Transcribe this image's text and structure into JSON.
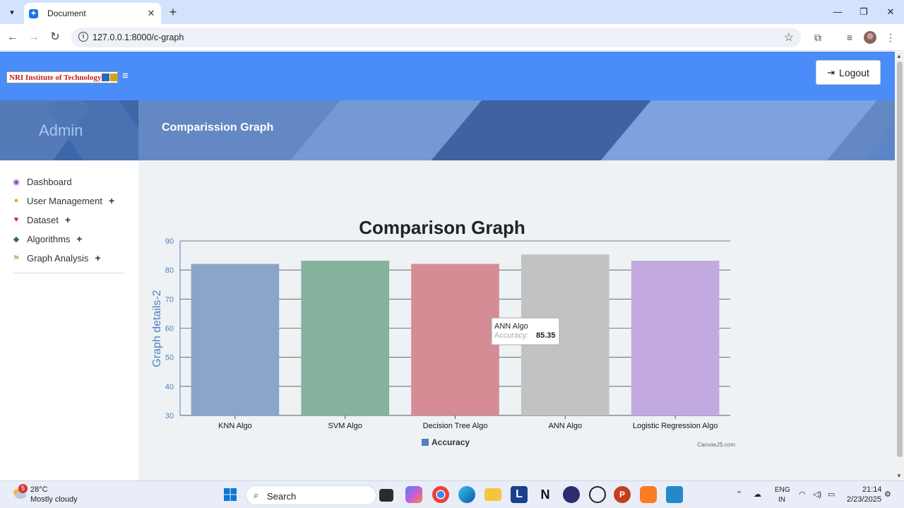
{
  "browser": {
    "tab_title": "Document",
    "url": "127.0.0.1:8000/c-graph"
  },
  "header": {
    "logo_text": "NRI Institute of Technology",
    "logout_label": "Logout"
  },
  "banner": {
    "admin_label": "Admin",
    "page_title": "Comparission Graph"
  },
  "sidebar": {
    "items": [
      {
        "label": "Dashboard",
        "icon": "dashboard-icon",
        "expandable": false
      },
      {
        "label": "User Management",
        "icon": "users-icon",
        "expandable": true
      },
      {
        "label": "Dataset",
        "icon": "heart-icon",
        "expandable": true
      },
      {
        "label": "Algorithms",
        "icon": "tags-icon",
        "expandable": true
      },
      {
        "label": "Graph Analysis",
        "icon": "flag-icon",
        "expandable": true
      }
    ]
  },
  "chart_data": {
    "type": "bar",
    "title": "Comparison Graph",
    "ylabel": "Graph details-2",
    "xlabel": "",
    "categories": [
      "KNN Algo",
      "SVM Algo",
      "Decision Tree Algo",
      "ANN Algo",
      "Logistic Regression Algo"
    ],
    "series": [
      {
        "name": "Accuracy",
        "values": [
          82.1,
          83.2,
          82.1,
          85.35,
          83.2
        ]
      }
    ],
    "bar_colors": [
      "#8ba5c9",
      "#85b39d",
      "#d58c95",
      "#c2c2c2",
      "#c2a9e0"
    ],
    "ylim": [
      30,
      90
    ],
    "yticks": [
      30,
      40,
      50,
      60,
      70,
      80,
      90
    ],
    "grid": true,
    "legend": "bottom-center",
    "legend_color": "#4f81bc",
    "credit": "CanvasJS.com",
    "tooltip": {
      "category": "ANN Algo",
      "series": "Accuracy",
      "value": "85.35"
    }
  },
  "taskbar": {
    "weather_badge": "5",
    "temperature": "28°C",
    "weather": "Mostly cloudy",
    "search_label": "Search",
    "lang_line1": "ENG",
    "lang_line2": "IN",
    "time": "21:14",
    "date": "2/23/2025"
  }
}
